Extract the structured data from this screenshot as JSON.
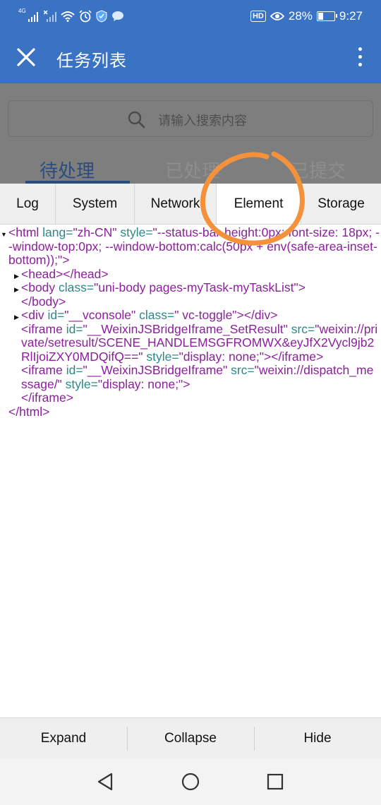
{
  "status_bar": {
    "network_type": "4G",
    "battery": "28%",
    "battery_level": 0.28,
    "time": "9:27",
    "hd_label": "HD",
    "icons": [
      "signal-icon",
      "signal-x-icon",
      "wifi-icon",
      "alarm-icon",
      "shield-icon",
      "chat-icon",
      "eye-icon",
      "battery-icon"
    ]
  },
  "header": {
    "title": "任务列表",
    "close_icon": "close-icon",
    "menu_icon": "more-vertical-icon"
  },
  "page": {
    "search_placeholder": "请输入搜索内容",
    "tabs": [
      {
        "label": "待处理"
      },
      {
        "label": "已处理"
      },
      {
        "label": "已提交"
      }
    ]
  },
  "vconsole": {
    "tabs": [
      {
        "label": "Log"
      },
      {
        "label": "System"
      },
      {
        "label": "Network"
      },
      {
        "label": "Element"
      },
      {
        "label": "Storage"
      }
    ],
    "active_tab": "Element",
    "tree": {
      "html_open": {
        "tag": "<html",
        "a1": " lang=",
        "v1": "\"zh-CN\"",
        "a2": " style=",
        "v2": "\"--status-bar-height:0px; font-size: 18px; --window-top:0px; --window-bottom:calc(50px + env(safe-area-inset-bottom));\"",
        "end": ">"
      },
      "head": {
        "open": "<head>",
        "close": "</head>"
      },
      "body_open": {
        "tag": "<body",
        "a1": " class=",
        "v1": "\"uni-body pages-myTask-myTaskList\"",
        "end": ">"
      },
      "body_close": "</body>",
      "div_open": {
        "tag": "<div",
        "a1": " id=",
        "v1": "\"__vconsole\"",
        "a2": " class=",
        "v2": "\" vc-toggle\"",
        "end": "></div>"
      },
      "iframe1": {
        "tag": "<iframe",
        "a1": " id=",
        "v1": "\"__WeixinJSBridgeIframe_SetResult\"",
        "a2": " src=",
        "v2": "\"weixin://private/setresult/SCENE_HANDLEMSGFROMWX&eyJfX2Vycl9jb2RlIjoiZXY0MDQifQ==\"",
        "a3": " style=",
        "v3": "\"display: none;\"",
        "end": "></iframe>"
      },
      "iframe2": {
        "tag": "<iframe",
        "a1": " id=",
        "v1": "\"__WeixinJSBridgeIframe\"",
        "a2": " src=",
        "v2": "\"weixin://dispatch_message/\"",
        "a3": " style=",
        "v3": "\"display: none;\"",
        "end": ">"
      },
      "iframe2_close": "</iframe>",
      "html_close": "</html>"
    },
    "toolbar": [
      {
        "label": "Expand"
      },
      {
        "label": "Collapse"
      },
      {
        "label": "Hide"
      }
    ]
  },
  "nav_bar": {
    "icons": [
      "back-triangle-icon",
      "home-circle-icon",
      "recents-square-icon"
    ]
  },
  "colors": {
    "app_bar": "#3a73c4",
    "overlay": "#7e7e7e",
    "tag": "#8b1f9c",
    "attribute": "#2a8a8a",
    "annotation": "#f3923b"
  }
}
